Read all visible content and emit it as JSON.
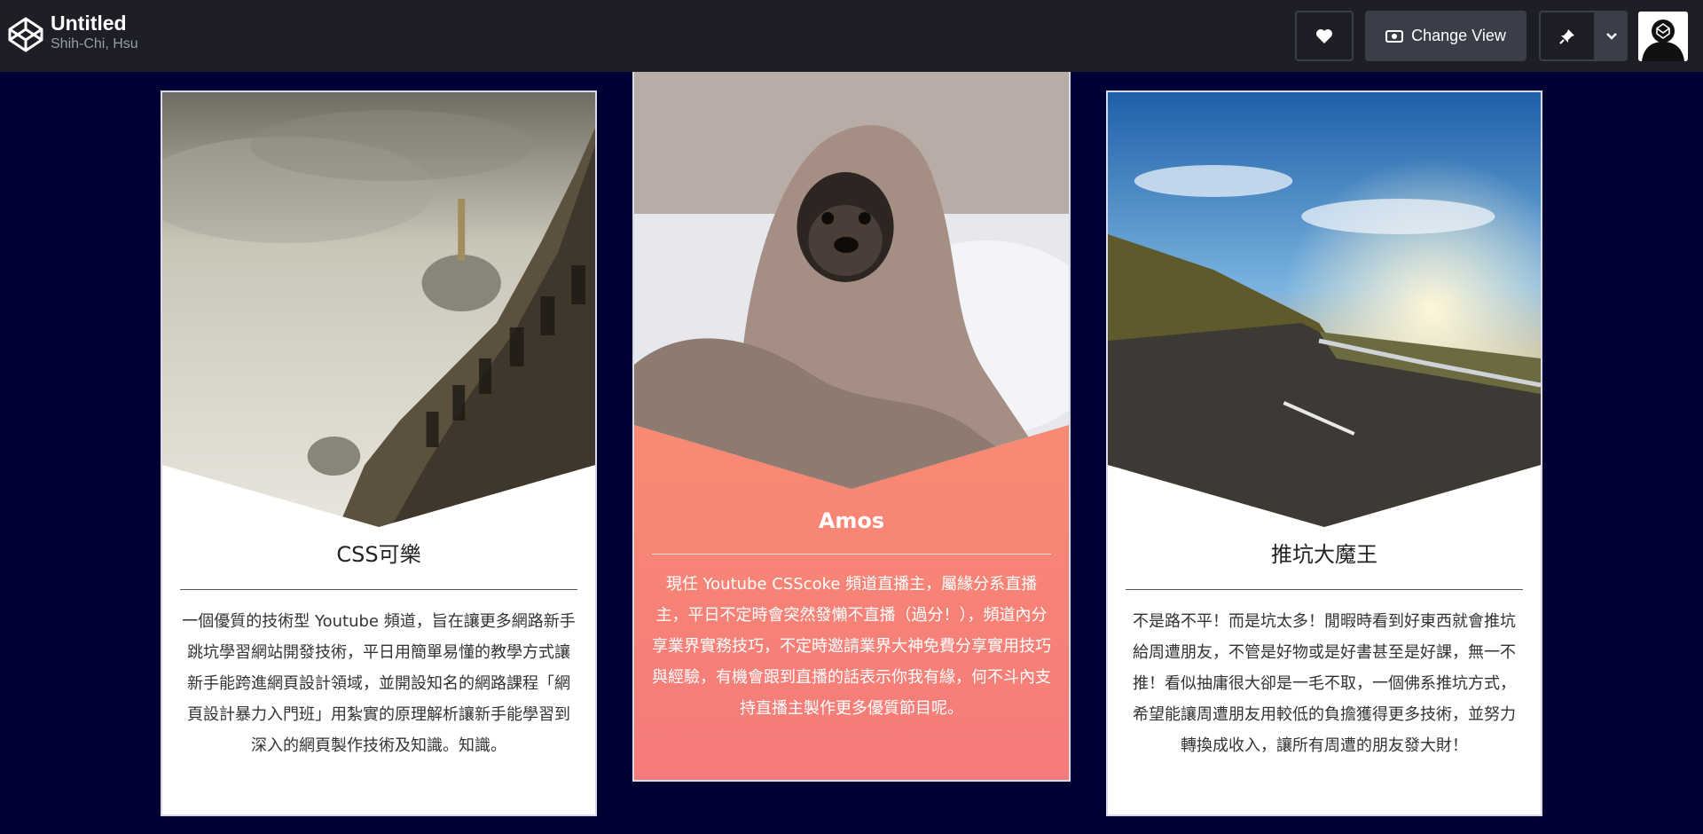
{
  "topbar": {
    "title": "Untitled",
    "author": "Shih-Chi, Hsu",
    "change_view_label": "Change View"
  },
  "cards": [
    {
      "name": "CSS可樂",
      "text": "一個優質的技術型 Youtube 頻道，旨在讓更多網路新手跳坑學習網站開發技術，平日用簡單易懂的教學方式讓新手能跨進網頁設計領域，並開設知名的網路課程「網頁設計暴力入門班」用紮實的原理解析讓新手能學習到深入的網頁製作技術及知識。知識。"
    },
    {
      "name": "Amos",
      "text": "現任 Youtube CSScoke 頻道直播主，屬緣分系直播主，平日不定時會突然發懶不直播（過分！），頻道內分享業界實務技巧，不定時邀請業界大神免費分享實用技巧與經驗，有機會跟到直播的話表示你我有緣，何不斗內支持直播主製作更多優質節目呢。"
    },
    {
      "name": "推坑大魔王",
      "text": "不是路不平！而是坑太多！閒暇時看到好東西就會推坑給周遭朋友，不管是好物或是好書甚至是好課，無一不推！看似抽庸很大卻是一毛不取，一個佛系推坑方式，希望能讓周遭朋友用較低的負擔獲得更多技術，並努力轉換成收入，讓所有周遭的朋友發大財！"
    }
  ],
  "icons": {
    "logo": "codepen-logo-icon",
    "heart": "heart-icon",
    "eye": "eye-icon",
    "pin": "pin-icon",
    "chevron": "chevron-down-icon"
  },
  "colors": {
    "background": "#000032",
    "topbar": "#1e1f26",
    "button": "#3b3d48",
    "accent_card_top": "#fb996d",
    "accent_card_bottom": "#f57b7a"
  }
}
